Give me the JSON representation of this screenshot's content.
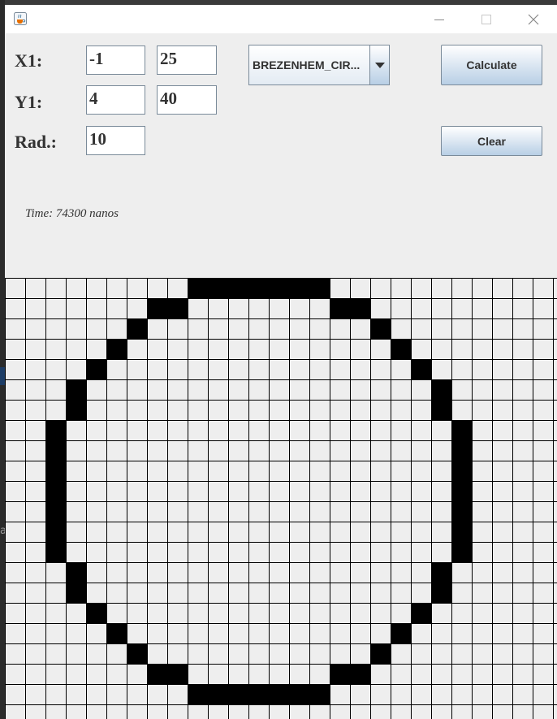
{
  "form": {
    "x1_label": "X1:",
    "y1_label": "Y1:",
    "rad_label": "Rad.:",
    "x1_value": "-1",
    "x2_value": "25",
    "y1_value": "4",
    "y2_value": "40",
    "rad_value": "10",
    "algorithm_selected": "BREZENHEM_CIR...",
    "calculate_label": "Calculate",
    "clear_label": "Clear"
  },
  "status": {
    "time_text": "Time: 74300 nanos"
  },
  "canvas": {
    "cols": 28,
    "rows": 22,
    "filled_cells": [
      [
        9,
        0
      ],
      [
        10,
        0
      ],
      [
        11,
        0
      ],
      [
        12,
        0
      ],
      [
        13,
        0
      ],
      [
        14,
        0
      ],
      [
        15,
        0
      ],
      [
        7,
        1
      ],
      [
        8,
        1
      ],
      [
        16,
        1
      ],
      [
        17,
        1
      ],
      [
        6,
        2
      ],
      [
        18,
        2
      ],
      [
        5,
        3
      ],
      [
        19,
        3
      ],
      [
        4,
        4
      ],
      [
        20,
        4
      ],
      [
        3,
        5
      ],
      [
        21,
        5
      ],
      [
        3,
        6
      ],
      [
        21,
        6
      ],
      [
        2,
        7
      ],
      [
        22,
        7
      ],
      [
        2,
        8
      ],
      [
        22,
        8
      ],
      [
        2,
        9
      ],
      [
        22,
        9
      ],
      [
        2,
        10
      ],
      [
        22,
        10
      ],
      [
        2,
        11
      ],
      [
        22,
        11
      ],
      [
        2,
        12
      ],
      [
        22,
        12
      ],
      [
        2,
        13
      ],
      [
        22,
        13
      ],
      [
        3,
        14
      ],
      [
        21,
        14
      ],
      [
        3,
        15
      ],
      [
        21,
        15
      ],
      [
        4,
        16
      ],
      [
        20,
        16
      ],
      [
        5,
        17
      ],
      [
        19,
        17
      ],
      [
        6,
        18
      ],
      [
        18,
        18
      ],
      [
        7,
        19
      ],
      [
        8,
        19
      ],
      [
        16,
        19
      ],
      [
        17,
        19
      ],
      [
        9,
        20
      ],
      [
        10,
        20
      ],
      [
        11,
        20
      ],
      [
        12,
        20
      ],
      [
        13,
        20
      ],
      [
        14,
        20
      ],
      [
        15,
        20
      ]
    ]
  },
  "colors": {
    "window_bg": "#eeeeee",
    "cell_fill": "#000000",
    "grid_line": "#000000"
  },
  "icons": {
    "app": "java-cup-icon",
    "minimize": "minimize-icon",
    "maximize": "maximize-icon",
    "close": "close-icon",
    "dropdown": "triangle-down-icon"
  }
}
